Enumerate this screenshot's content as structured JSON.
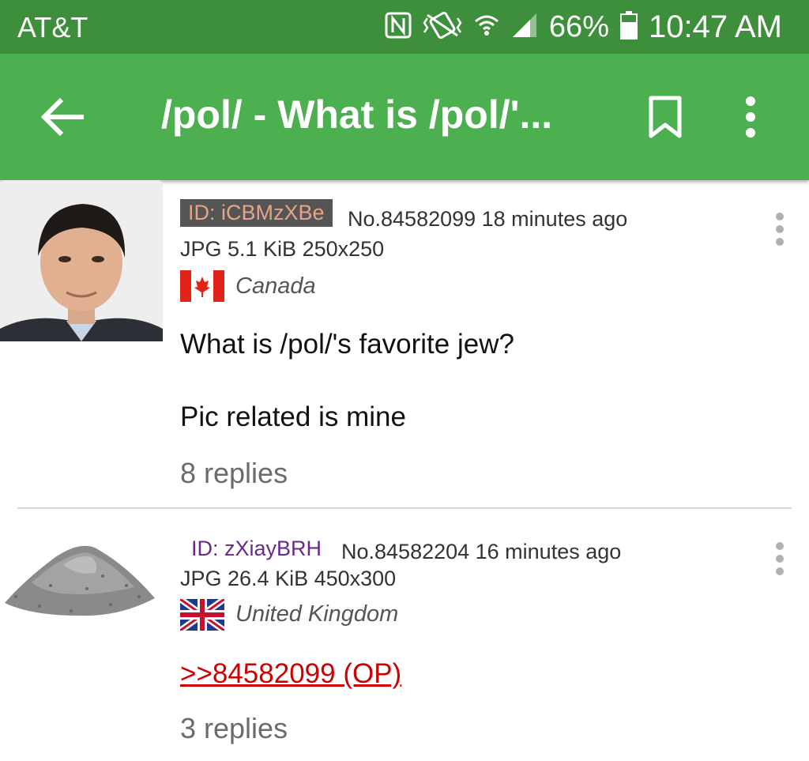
{
  "status_bar": {
    "carrier": "AT&T",
    "battery": "66%",
    "time": "10:47 AM",
    "icons": [
      "nfc-icon",
      "vibrate-icon",
      "wifi-icon",
      "signal-icon",
      "battery-icon"
    ]
  },
  "toolbar": {
    "title": "/pol/ - What is /pol/'...",
    "icons": [
      "back-arrow-icon",
      "bookmark-icon",
      "overflow-menu-icon"
    ]
  },
  "colors": {
    "statusbar": "#3d8f3c",
    "toolbar": "#4caf50",
    "id_badge_bg": "#555555",
    "id_badge_text": "#e8a287",
    "id2_text": "#6a2a8a",
    "quote_link": "#cc0000"
  },
  "posts": [
    {
      "id_label": "ID: iCBMzXBe",
      "number_time": "No.84582099 18 minutes ago",
      "file_info": "JPG 5.1 KiB 250x250",
      "country": "Canada",
      "flag": "canada-flag",
      "body": [
        "What is /pol/'s favorite jew?",
        "Pic related is mine"
      ],
      "replies": "8 replies"
    },
    {
      "id_label": "ID: zXiayBRH",
      "number_time": "No.84582204 16 minutes ago",
      "file_info": "JPG 26.4 KiB 450x300",
      "country": "United Kingdom",
      "flag": "uk-flag",
      "quote": ">>84582099 (OP)",
      "replies": "3 replies"
    }
  ]
}
